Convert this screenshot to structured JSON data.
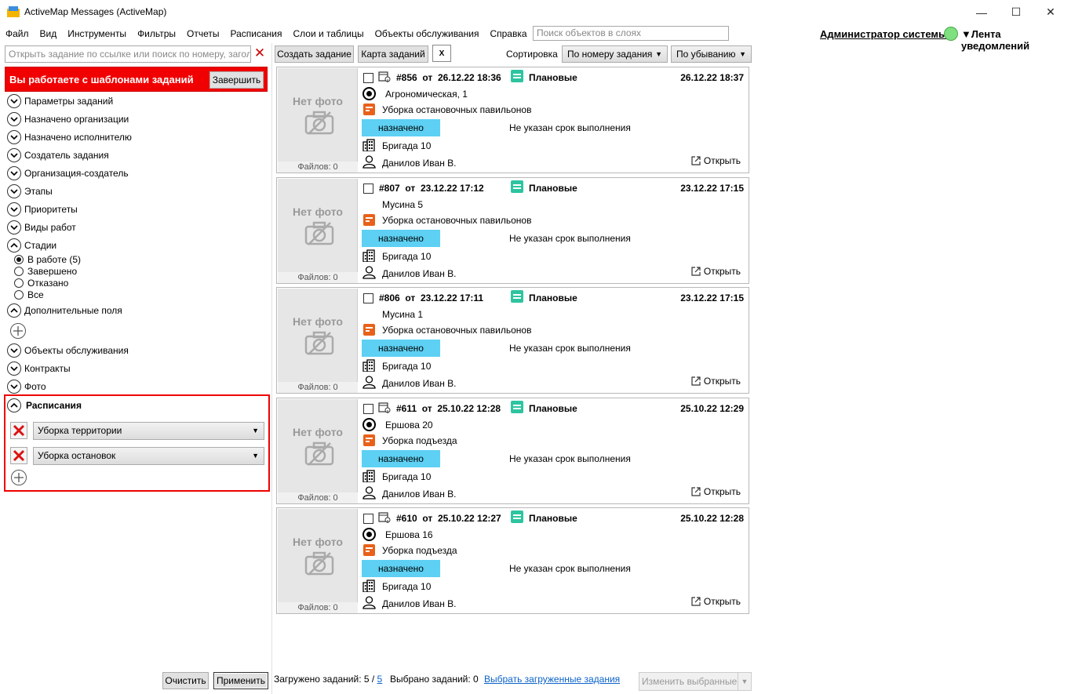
{
  "window": {
    "title": "ActiveMap Messages (ActiveMap)",
    "minimize": "—",
    "maximize": "☐",
    "close": "✕"
  },
  "menu": [
    "Файл",
    "Вид",
    "Инструменты",
    "Фильтры",
    "Отчеты",
    "Расписания",
    "Слои и таблицы",
    "Объекты обслуживания",
    "Справка"
  ],
  "layer_search": {
    "placeholder": "Поиск объектов в слоях"
  },
  "header_right": {
    "admin": "Администратор системы",
    "feed": "▼Лента уведомлений",
    "status_color": "#7fe07f"
  },
  "left": {
    "task_search_placeholder": "Открыть задание по ссылке или поиск по номеру, заголовку",
    "banner_text": "Вы работаете с шаблонами заданий",
    "banner_button": "Завершить",
    "banner_color": "#f00000",
    "filters_top": [
      "Параметры заданий",
      "Назначено организации",
      "Назначено исполнителю",
      "Создатель задания",
      "Организация-создатель",
      "Этапы",
      "Приоритеты",
      "Виды работ"
    ],
    "stages_label": "Стадии",
    "stages": [
      {
        "label": "В работе (5)",
        "selected": true
      },
      {
        "label": "Завершено",
        "selected": false
      },
      {
        "label": "Отказано",
        "selected": false
      },
      {
        "label": "Все",
        "selected": false
      }
    ],
    "extra_fields_label": "Дополнительные поля",
    "filters_bottom": [
      "Объекты обслуживания",
      "Контракты",
      "Фото"
    ],
    "schedules": {
      "title": "Расписания",
      "items": [
        "Уборка территории",
        "Уборка остановок"
      ]
    },
    "clear_button": "Очистить",
    "apply_button": "Применить"
  },
  "toolbar": {
    "create_task": "Создать задание",
    "task_map": "Карта заданий",
    "excel": "X",
    "sort_label": "Сортировка",
    "sort_by": "По номеру задания",
    "sort_order": "По убыванию"
  },
  "cards": [
    {
      "number": "#856",
      "from": "от",
      "created": "26.12.22 18:36",
      "type": "Плановые",
      "date": "26.12.22 18:37",
      "has_target": true,
      "address": "Агрономическая, 1",
      "work": "Уборка остановочных павильонов",
      "status": "назначено",
      "deadline": "Не указан срок выполнения",
      "brigade": "Бригада 10",
      "person": "Данилов Иван В.",
      "open": "Открыть",
      "no_photo": "Нет фото",
      "files": "Файлов: 0",
      "has_pin": true
    },
    {
      "number": "#807",
      "from": "от",
      "created": "23.12.22 17:12",
      "type": "Плановые",
      "date": "23.12.22 17:15",
      "has_target": false,
      "address": "Мусина 5",
      "work": "Уборка остановочных павильонов",
      "status": "назначено",
      "deadline": "Не указан срок выполнения",
      "brigade": "Бригада 10",
      "person": "Данилов Иван В.",
      "open": "Открыть",
      "no_photo": "Нет фото",
      "files": "Файлов: 0",
      "has_pin": false
    },
    {
      "number": "#806",
      "from": "от",
      "created": "23.12.22 17:11",
      "type": "Плановые",
      "date": "23.12.22 17:15",
      "has_target": false,
      "address": "Мусина 1",
      "work": "Уборка остановочных павильонов",
      "status": "назначено",
      "deadline": "Не указан срок выполнения",
      "brigade": "Бригада 10",
      "person": "Данилов Иван В.",
      "open": "Открыть",
      "no_photo": "Нет фото",
      "files": "Файлов: 0",
      "has_pin": false
    },
    {
      "number": "#611",
      "from": "от",
      "created": "25.10.22 12:28",
      "type": "Плановые",
      "date": "25.10.22 12:29",
      "has_target": true,
      "address": "Ершова 20",
      "work": "Уборка подъезда",
      "status": "назначено",
      "deadline": "Не указан срок выполнения",
      "brigade": "Бригада 10",
      "person": "Данилов Иван В.",
      "open": "Открыть",
      "no_photo": "Нет фото",
      "files": "Файлов: 0",
      "has_pin": true
    },
    {
      "number": "#610",
      "from": "от",
      "created": "25.10.22 12:27",
      "type": "Плановые",
      "date": "25.10.22 12:28",
      "has_target": true,
      "address": "Ершова 16",
      "work": "Уборка подъезда",
      "status": "назначено",
      "deadline": "Не указан срок выполнения",
      "brigade": "Бригада 10",
      "person": "Данилов Иван В.",
      "open": "Открыть",
      "no_photo": "Нет фото",
      "files": "Файлов: 0",
      "has_pin": true
    }
  ],
  "footer": {
    "loaded_label": "Загружено заданий: 5 /",
    "loaded_total": "5",
    "selected_label": "Выбрано заданий: 0",
    "select_loaded": "Выбрать загруженные задания",
    "change_selected": "Изменить выбранные"
  }
}
